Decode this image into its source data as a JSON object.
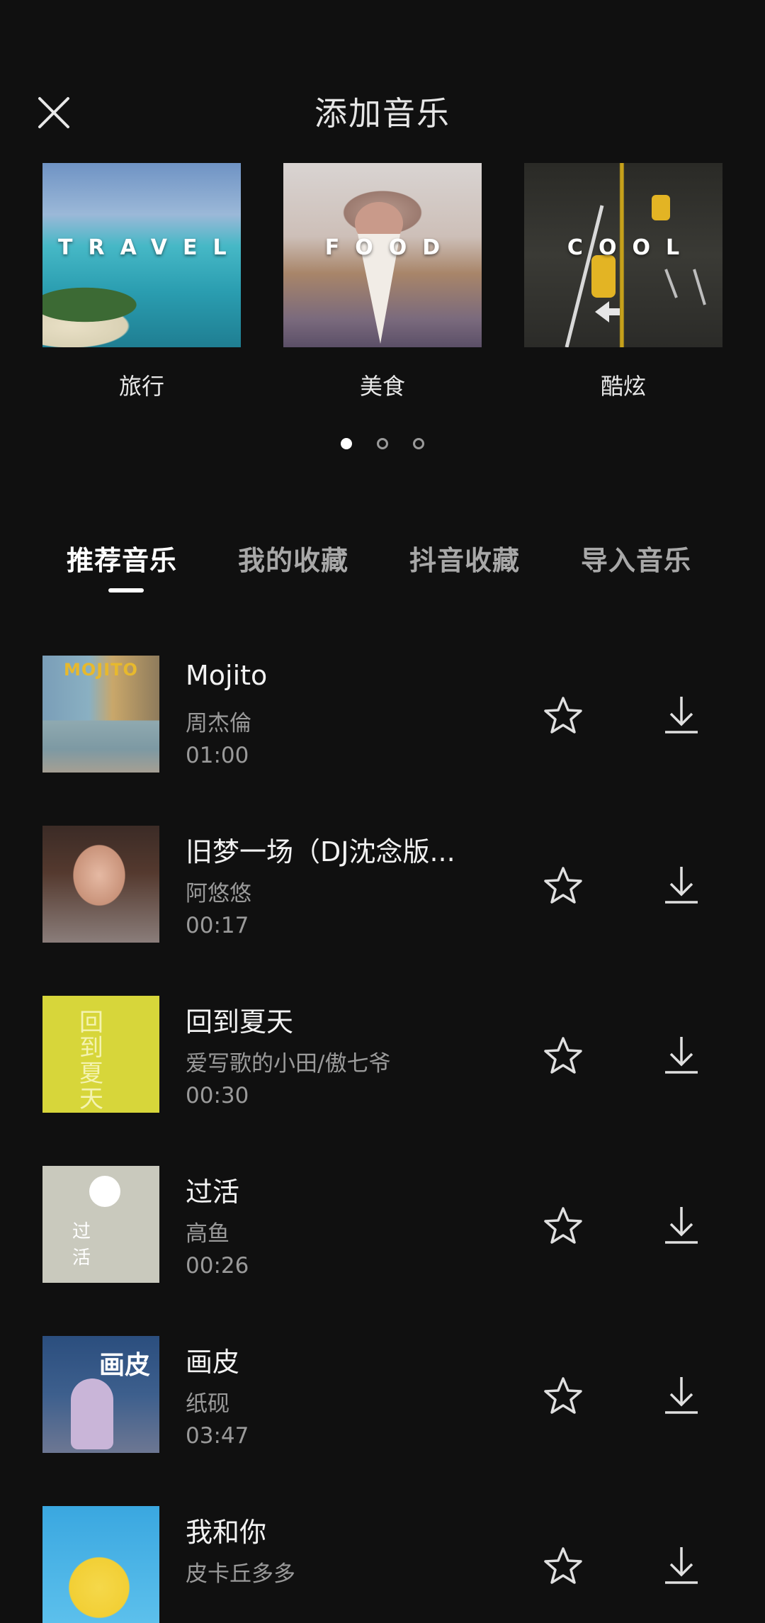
{
  "header": {
    "title": "添加音乐"
  },
  "categories": [
    {
      "overlay": "TRAVEL",
      "label": "旅行"
    },
    {
      "overlay": "FOOD",
      "label": "美食"
    },
    {
      "overlay": "COOL",
      "label": "酷炫"
    }
  ],
  "pager": {
    "pages": 3,
    "active": 0
  },
  "tabs": [
    {
      "label": "推荐音乐",
      "active": true
    },
    {
      "label": "我的收藏",
      "active": false
    },
    {
      "label": "抖音收藏",
      "active": false
    },
    {
      "label": "导入音乐",
      "active": false
    }
  ],
  "songs": [
    {
      "title": "Mojito",
      "artist": "周杰倫",
      "duration": "01:00",
      "cover_text": "MOJITO"
    },
    {
      "title": "旧梦一场（DJ沈念版...",
      "artist": "阿悠悠",
      "duration": "00:17",
      "cover_text": ""
    },
    {
      "title": "回到夏天",
      "artist": "爱写歌的小田/傲七爷",
      "duration": "00:30",
      "cover_text": "回到夏天"
    },
    {
      "title": "过活",
      "artist": "高鱼",
      "duration": "00:26",
      "cover_text": "过 活"
    },
    {
      "title": "画皮",
      "artist": "纸砚",
      "duration": "03:47",
      "cover_text": "画皮"
    },
    {
      "title": "我和你",
      "artist": "皮卡丘多多",
      "duration": "",
      "cover_text": ""
    }
  ],
  "colors": {
    "background": "#101010",
    "text_primary": "#f2f2f2",
    "text_secondary": "#9a9a9a"
  }
}
